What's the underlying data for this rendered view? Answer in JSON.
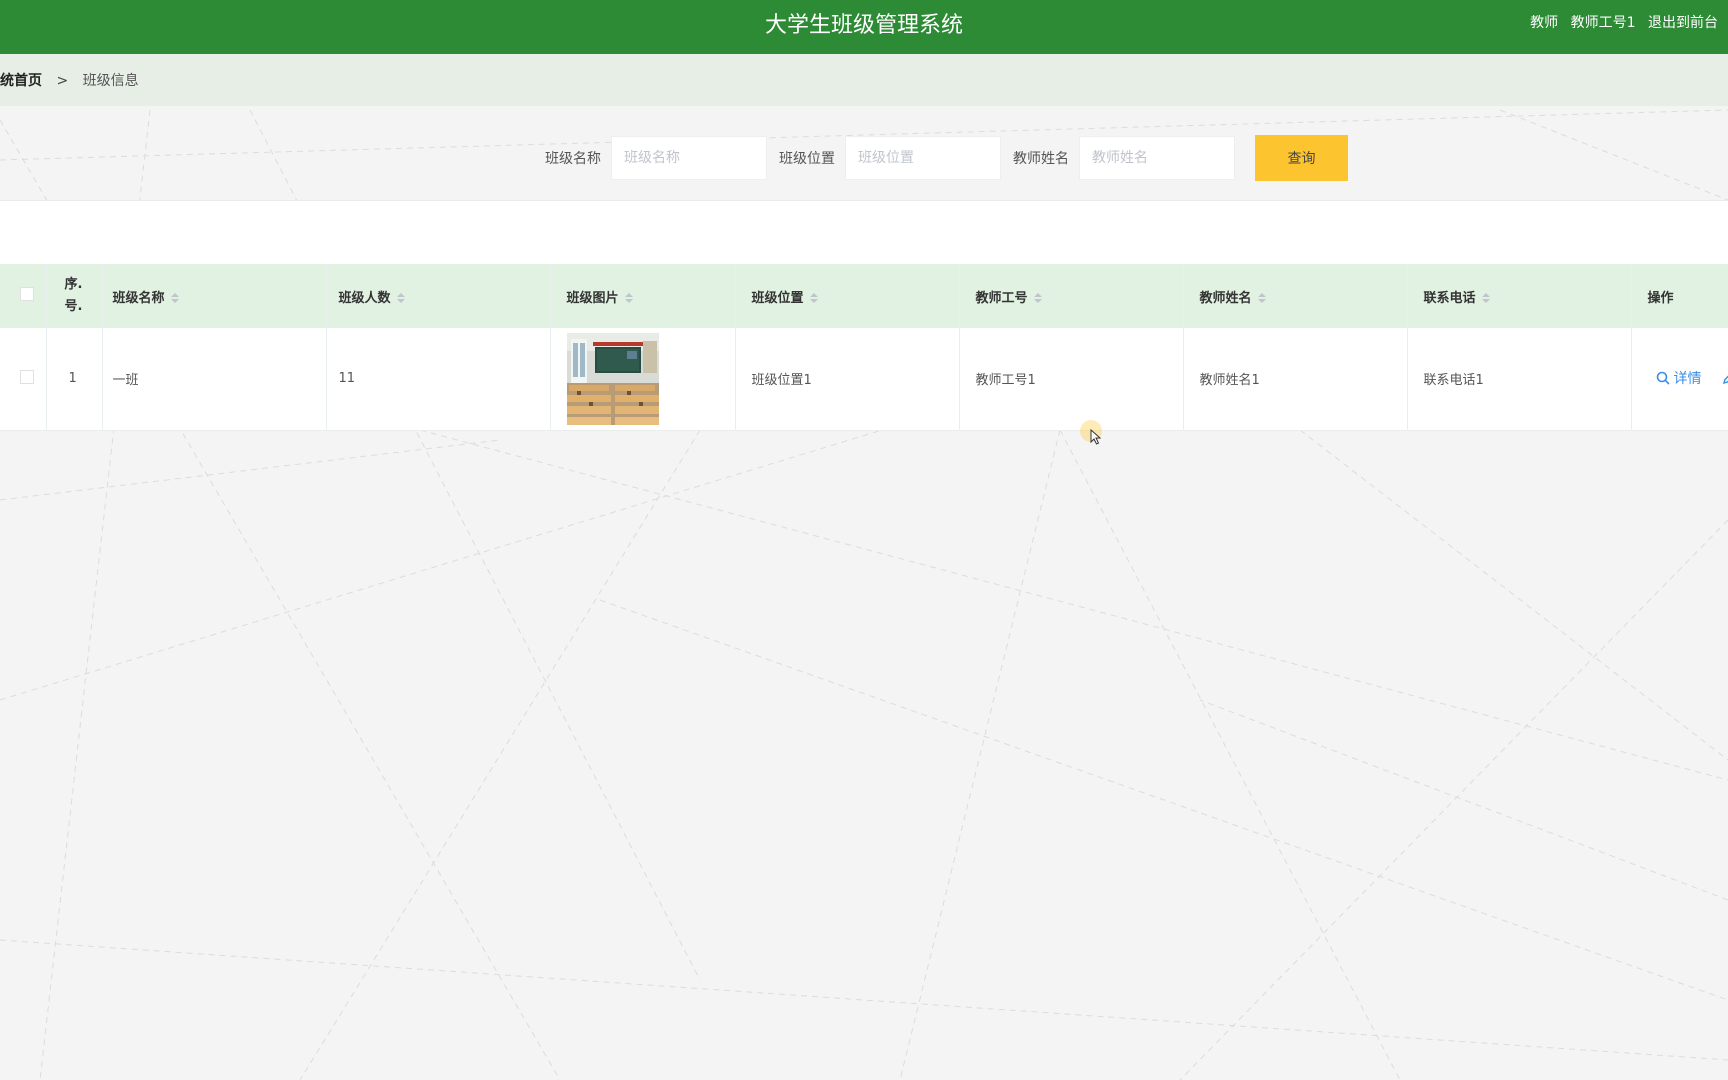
{
  "header": {
    "title": "大学生班级管理系统",
    "user_role": "教师",
    "user_name": "教师工号1",
    "logout_label": "退出到前台",
    "background_color": "#2d8a35"
  },
  "breadcrumb": {
    "home": "统首页",
    "separator": ">",
    "current": "班级信息"
  },
  "search": {
    "fields": [
      {
        "label": "班级名称",
        "placeholder": "班级名称",
        "value": ""
      },
      {
        "label": "班级位置",
        "placeholder": "班级位置",
        "value": ""
      },
      {
        "label": "教师姓名",
        "placeholder": "教师姓名",
        "value": ""
      }
    ],
    "button_label": "查询",
    "button_color": "#fcc52f"
  },
  "table": {
    "columns": [
      "序号",
      "班级名称",
      "班级人数",
      "班级图片",
      "班级位置",
      "教师工号",
      "教师姓名",
      "联系电话",
      "操作"
    ],
    "seq_header_line1": "序.",
    "seq_header_line2": "号.",
    "rows": [
      {
        "seq": "1",
        "class_name": "一班",
        "class_size": "11",
        "class_image": "classroom-photo",
        "class_location": "班级位置1",
        "teacher_id": "教师工号1",
        "teacher_name": "教师姓名1",
        "phone": "联系电话1",
        "detail_label": "详情"
      }
    ],
    "header_color": "#e1f2e2"
  },
  "icons": {
    "search": "search-icon",
    "edit": "edit-icon",
    "sort": "sort-icon"
  }
}
